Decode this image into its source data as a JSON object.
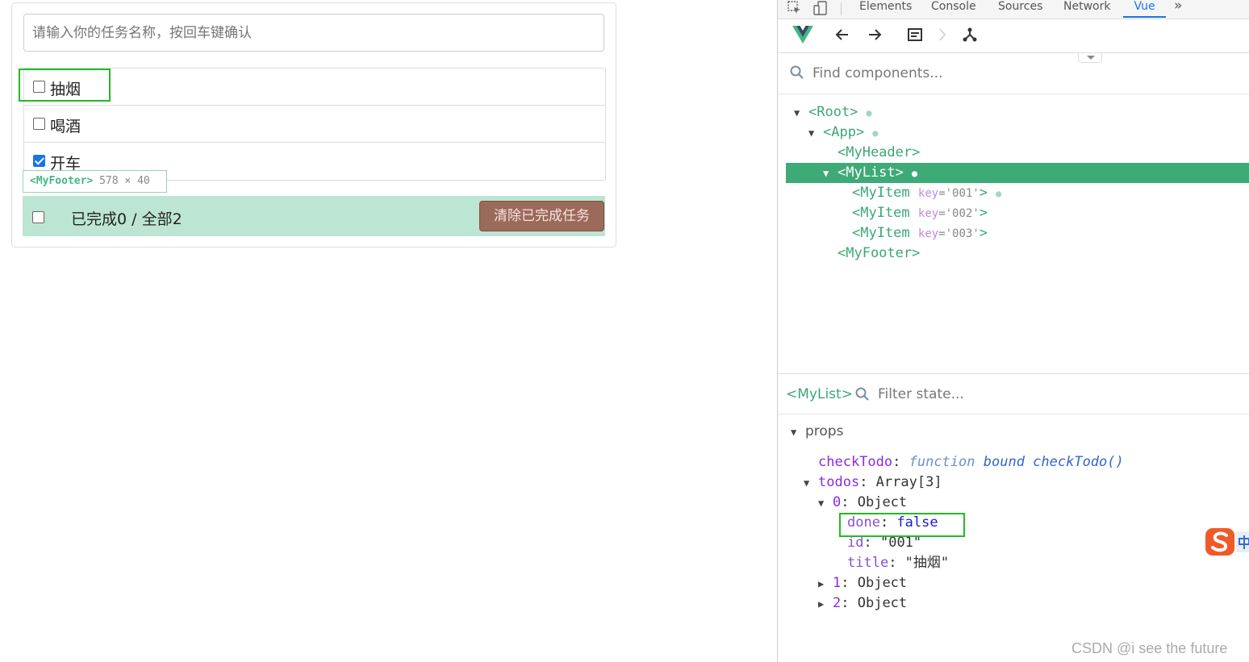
{
  "todo": {
    "input_placeholder": "请输入你的任务名称，按回车键确认",
    "items": [
      {
        "label": "抽烟",
        "done": false
      },
      {
        "label": "喝酒",
        "done": false
      },
      {
        "label": "开车",
        "done": true
      }
    ],
    "tooltip": {
      "tag": "MyFooter",
      "size": "578 × 40"
    },
    "footer": {
      "status": "已完成0 / 全部2",
      "clear_label": "清除已完成任务"
    }
  },
  "devtools": {
    "tabs": [
      "Elements",
      "Console",
      "Sources",
      "Network",
      "Vue"
    ],
    "active_tab": "Vue",
    "more": "»",
    "find_placeholder": "Find components...",
    "tree": [
      {
        "tag": "Root",
        "text": "<Root>",
        "expanded": true
      },
      {
        "tag": "App",
        "text": "<App>",
        "expanded": true
      },
      {
        "tag": "MyHeader",
        "text": "<MyHeader>"
      },
      {
        "tag": "MyList",
        "text": "<MyList>",
        "expanded": true,
        "selected": true
      },
      {
        "tag": "MyItem",
        "text": "<MyItem",
        "key_attr": "key",
        "key_val": "='001'",
        "close": ">"
      },
      {
        "tag": "MyItem",
        "text": "<MyItem",
        "key_attr": "key",
        "key_val": "='002'",
        "close": ">"
      },
      {
        "tag": "MyItem",
        "text": "<MyItem",
        "key_attr": "key",
        "key_val": "='003'",
        "close": ">"
      },
      {
        "tag": "MyFooter",
        "text": "<MyFooter>"
      }
    ],
    "selected_component": "<MyList>",
    "filter_placeholder": "Filter state...",
    "props_title": "props",
    "props": {
      "checkTodo_key": "checkTodo",
      "checkTodo_kw": "function",
      "checkTodo_val": "bound checkTodo()",
      "todos_key": "todos",
      "todos_val": "Array[3]",
      "item0_key": "0",
      "item0_val": "Object",
      "done_key": "done",
      "done_val": "false",
      "id_key": "id",
      "id_val": "\"001\"",
      "title_key": "title",
      "title_val": "\"抽烟\"",
      "item1_key": "1",
      "item1_val": "Object",
      "item2_key": "2",
      "item2_val": "Object"
    }
  },
  "watermark": "CSDN @i see the future",
  "colors": {
    "vue_green": "#41b883",
    "selected_row": "#3daa77",
    "footer_bg": "#bde5d4",
    "clear_btn": "#9c6a5b",
    "highlight": "#22bb22"
  }
}
